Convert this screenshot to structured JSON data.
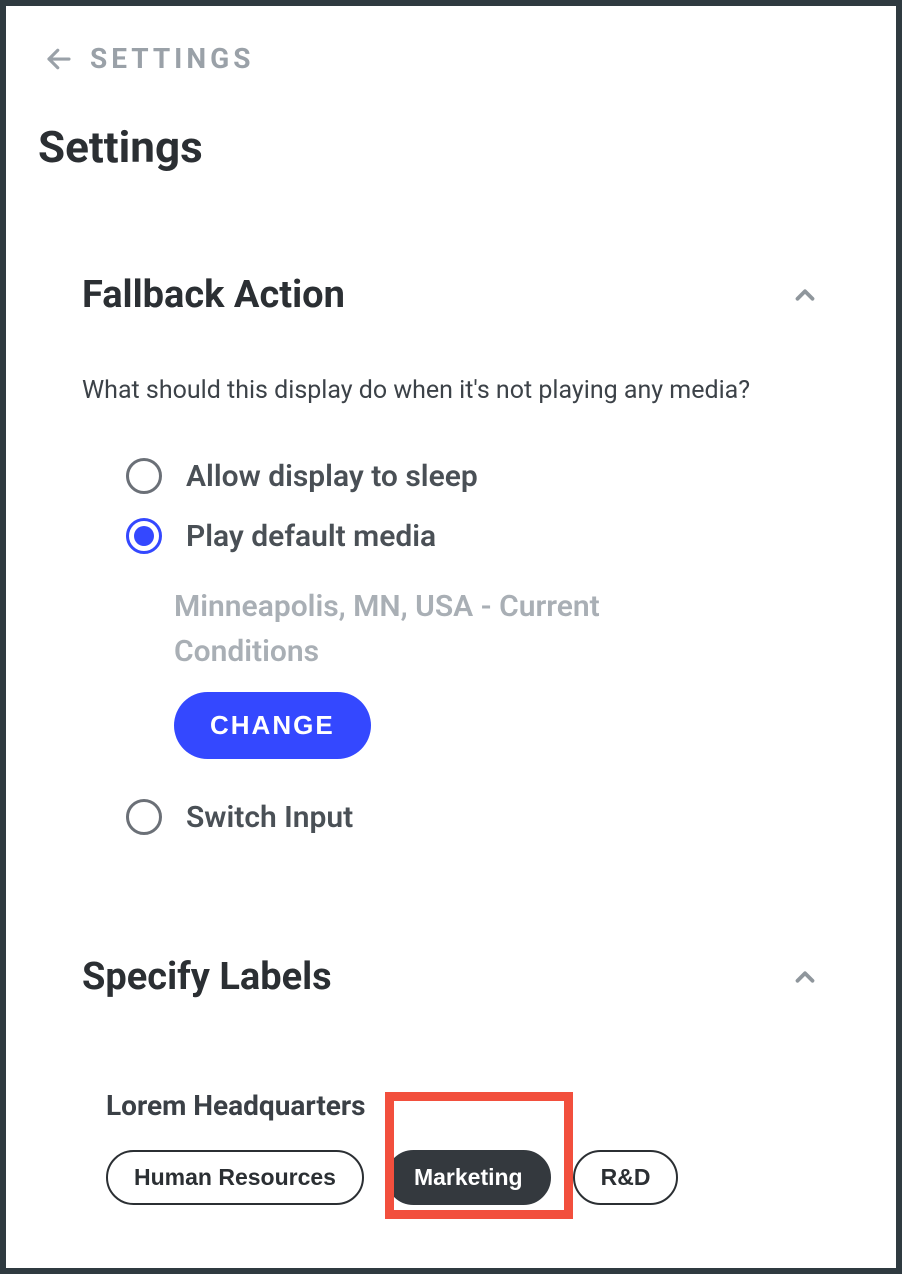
{
  "breadcrumb": {
    "label": "SETTINGS"
  },
  "page": {
    "title": "Settings"
  },
  "fallback": {
    "title": "Fallback Action",
    "description": "What should this display do when it's not playing any media?",
    "options": {
      "sleep": "Allow display to sleep",
      "default_media": "Play default media",
      "switch_input": "Switch Input"
    },
    "selected": "default_media",
    "media_name": "Minneapolis, MN, USA - Current Conditions",
    "change_label": "CHANGE"
  },
  "labels": {
    "title": "Specify Labels",
    "group_name": "Lorem Headquarters",
    "chips": [
      "Human Resources",
      "Marketing",
      "R&D"
    ],
    "selected_chip": "Marketing"
  }
}
